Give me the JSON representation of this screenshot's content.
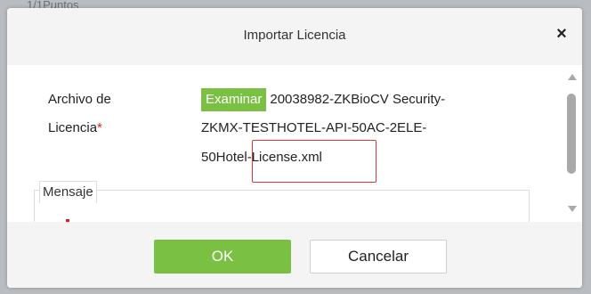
{
  "background": {
    "text": "1/1Puntos"
  },
  "dialog": {
    "title": "Importar Licencia",
    "close_glyph": "×",
    "field_label_line1": "Archivo de",
    "field_label_line2": "Licencia",
    "required_mark": "*",
    "browse_label": "Examinar",
    "file_name_line1": "20038982-ZKBioCV Security-",
    "file_name_line2": "ZKMX-TESTHOTEL-API-50AC-2ELE-",
    "file_name_line3": "50Hotel-License.xml",
    "message_legend": "Mensaje"
  },
  "footer": {
    "ok_label": "OK",
    "cancel_label": "Cancelar"
  },
  "colors": {
    "accent_green": "#7ac143",
    "highlight_red": "#e0343a",
    "required_red": "#e02020"
  },
  "icons": [
    "close-icon",
    "scroll-up-arrow-icon",
    "scroll-down-arrow-icon"
  ]
}
